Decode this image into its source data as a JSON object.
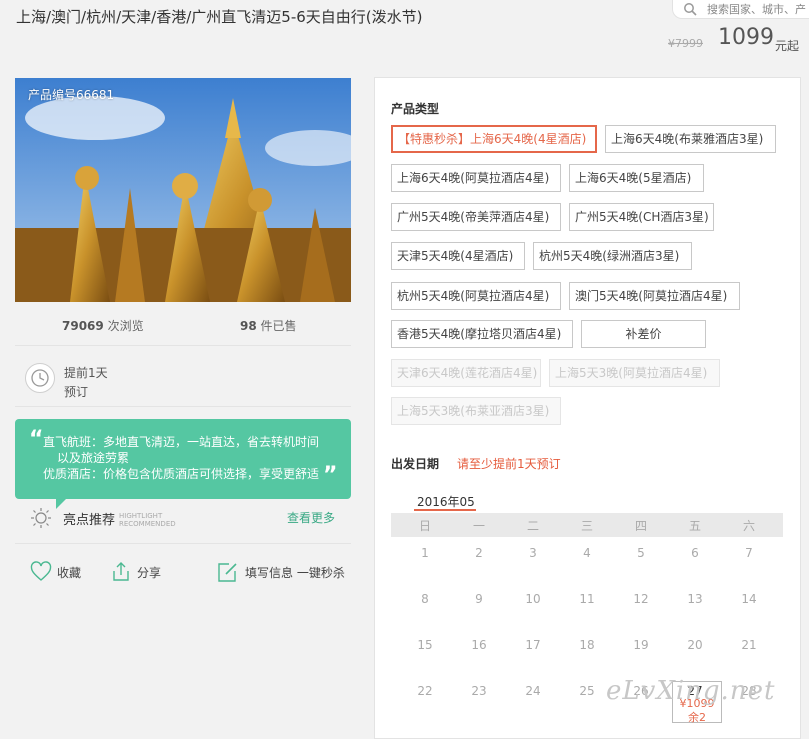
{
  "title": "上海/澳门/杭州/天津/香港/广州直飞清迈5-6天自由行(泼水节)",
  "search": {
    "placeholder": "搜索国家、城市、产"
  },
  "price": {
    "original": "¥7999",
    "current": "1099",
    "unit": "元起"
  },
  "product_no": "产品编号66681",
  "stats": {
    "views": "79069",
    "views_label": "次浏览",
    "sold": "98",
    "sold_label": "件已售"
  },
  "advance": {
    "line1": "提前1天",
    "line2": "预订"
  },
  "highlight": {
    "line1": "直飞航班：多地直飞清迈，一站直达，省去转机时间",
    "line2": "以及旅途劳累",
    "line3": "优质酒店：价格包含优质酒店可供选择，享受更舒适",
    "rec_label": "亮点推荐",
    "rec_en1": "HIGHTLIGHT",
    "rec_en2": "RECOMMENDED",
    "see_more": "查看更多"
  },
  "actions": {
    "favorite": "收藏",
    "share": "分享",
    "quick_buy": "填写信息 一键秒杀"
  },
  "product_type": {
    "label": "产品类型",
    "options": [
      {
        "text": "【特惠秒杀】上海6天4晚(4星酒店)",
        "state": "selected"
      },
      {
        "text": "上海6天4晚(布莱雅酒店3星)",
        "state": "normal"
      },
      {
        "text": "上海6天4晚(阿莫拉酒店4星)",
        "state": "normal"
      },
      {
        "text": "上海6天4晚(5星酒店)",
        "state": "normal"
      },
      {
        "text": "广州5天4晚(帝美萍酒店4星)",
        "state": "normal"
      },
      {
        "text": "广州5天4晚(CH酒店3星)",
        "state": "normal"
      },
      {
        "text": "天津5天4晚(4星酒店)",
        "state": "normal"
      },
      {
        "text": "杭州5天4晚(绿洲酒店3星)",
        "state": "normal"
      },
      {
        "text": "杭州5天4晚(阿莫拉酒店4星)",
        "state": "normal"
      },
      {
        "text": "澳门5天4晚(阿莫拉酒店4星)",
        "state": "normal"
      },
      {
        "text": "香港5天4晚(摩拉塔贝酒店4星)",
        "state": "normal"
      },
      {
        "text": "补差价",
        "state": "normal"
      },
      {
        "text": "天津6天4晚(莲花酒店4星)",
        "state": "disabled"
      },
      {
        "text": "上海5天3晚(阿莫拉酒店4星)",
        "state": "disabled"
      },
      {
        "text": "上海5天3晚(布莱亚酒店3星)",
        "state": "disabled"
      }
    ]
  },
  "departure": {
    "label": "出发日期",
    "note": "请至少提前1天预订"
  },
  "calendar": {
    "month": "2016年05",
    "weekdays": [
      "日",
      "一",
      "二",
      "三",
      "四",
      "五",
      "六"
    ],
    "rows": [
      [
        "1",
        "2",
        "3",
        "4",
        "5",
        "6",
        "7"
      ],
      [
        "8",
        "9",
        "10",
        "11",
        "12",
        "13",
        "14"
      ],
      [
        "15",
        "16",
        "17",
        "18",
        "19",
        "20",
        "21"
      ],
      [
        "22",
        "23",
        "24",
        "25",
        "26",
        "27",
        "28"
      ]
    ],
    "available_day": {
      "day": "27",
      "price": "¥1099",
      "remaining": "余2"
    }
  },
  "watermark": "eLvXing.net",
  "colors": {
    "accent_green": "#55c7a2",
    "accent_red": "#e5674a"
  }
}
